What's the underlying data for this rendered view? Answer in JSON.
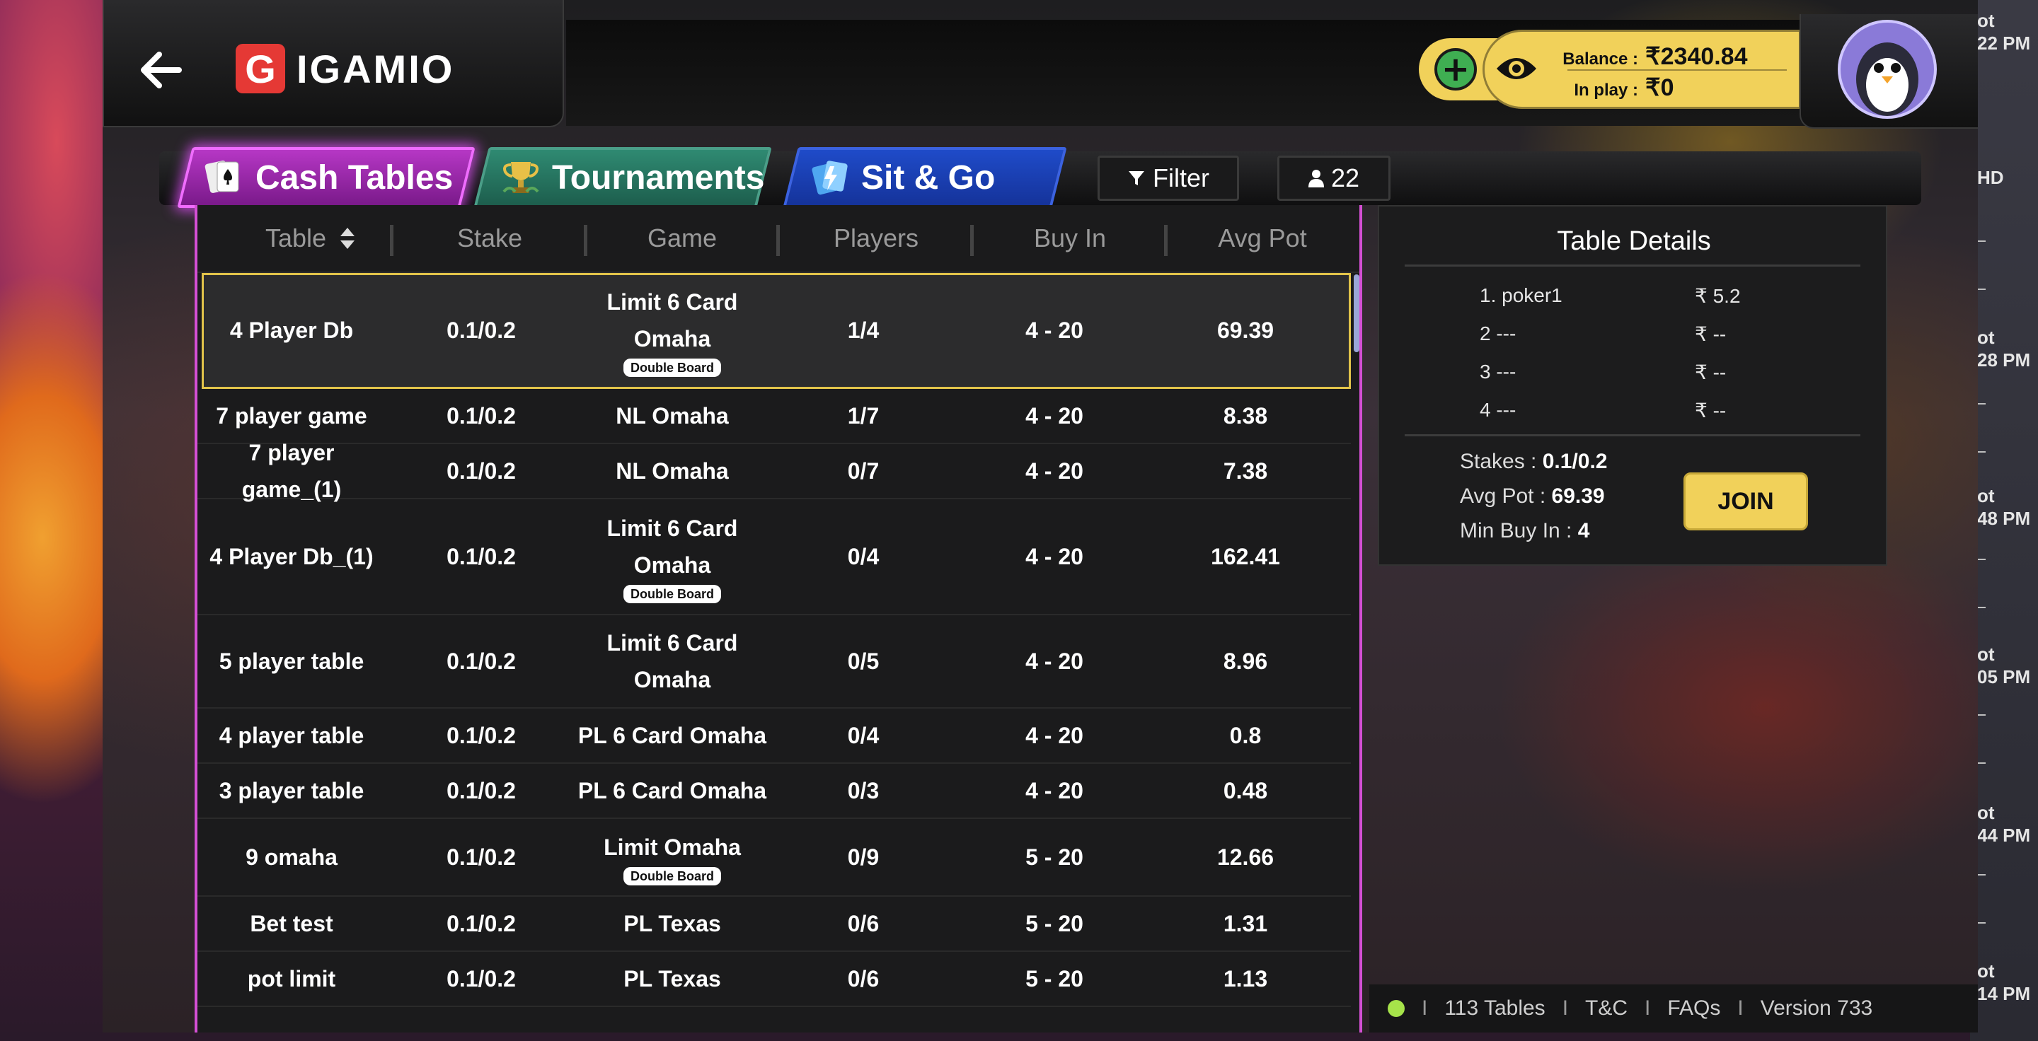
{
  "header": {
    "logo_text": "IGAMIO",
    "logo_mark": "G",
    "balance_label": "Balance :",
    "balance_value": "₹2340.84",
    "inplay_label": "In play :",
    "inplay_value": "₹0"
  },
  "tabs": [
    {
      "label": "Cash Tables",
      "icon": "cards-icon",
      "active": true
    },
    {
      "label": "Tournaments",
      "icon": "trophy-icon",
      "active": false
    },
    {
      "label": "Sit & Go",
      "icon": "lightning-card-icon",
      "active": false
    }
  ],
  "toolbar": {
    "filter_label": "Filter",
    "players_count": "22"
  },
  "table": {
    "columns": [
      "Table",
      "Stake",
      "Game",
      "Players",
      "Buy In",
      "Avg Pot"
    ],
    "rows": [
      {
        "name": "4 Player Db",
        "stake": "0.1/0.2",
        "game": "Limit 6 Card Omaha",
        "badge": "Double Board",
        "players": "1/4",
        "buyin": "4 - 20",
        "avgpot": "69.39",
        "selected": true
      },
      {
        "name": "7 player game",
        "stake": "0.1/0.2",
        "game": "NL Omaha",
        "badge": "",
        "players": "1/7",
        "buyin": "4 - 20",
        "avgpot": "8.38"
      },
      {
        "name": "7 player game_(1)",
        "stake": "0.1/0.2",
        "game": "NL Omaha",
        "badge": "",
        "players": "0/7",
        "buyin": "4 - 20",
        "avgpot": "7.38"
      },
      {
        "name": "4 Player Db_(1)",
        "stake": "0.1/0.2",
        "game": "Limit 6 Card Omaha",
        "badge": "Double Board",
        "players": "0/4",
        "buyin": "4 - 20",
        "avgpot": "162.41"
      },
      {
        "name": "5 player table",
        "stake": "0.1/0.2",
        "game": "Limit 6 Card Omaha",
        "badge": "",
        "players": "0/5",
        "buyin": "4 - 20",
        "avgpot": "8.96"
      },
      {
        "name": "4 player table",
        "stake": "0.1/0.2",
        "game": "PL 6 Card Omaha",
        "badge": "",
        "players": "0/4",
        "buyin": "4 - 20",
        "avgpot": "0.8"
      },
      {
        "name": "3 player table",
        "stake": "0.1/0.2",
        "game": "PL 6 Card Omaha",
        "badge": "",
        "players": "0/3",
        "buyin": "4 - 20",
        "avgpot": "0.48"
      },
      {
        "name": "9 omaha",
        "stake": "0.1/0.2",
        "game": "Limit Omaha",
        "badge": "Double Board",
        "players": "0/9",
        "buyin": "5 - 20",
        "avgpot": "12.66"
      },
      {
        "name": "Bet test",
        "stake": "0.1/0.2",
        "game": "PL Texas",
        "badge": "",
        "players": "0/6",
        "buyin": "5 - 20",
        "avgpot": "1.31"
      },
      {
        "name": "pot limit",
        "stake": "0.1/0.2",
        "game": "PL Texas",
        "badge": "",
        "players": "0/6",
        "buyin": "5 - 20",
        "avgpot": "1.13"
      }
    ]
  },
  "details": {
    "title": "Table Details",
    "seats": [
      {
        "name": "1. poker1",
        "amount": "₹ 5.2"
      },
      {
        "name": "2 ---",
        "amount": "₹ --"
      },
      {
        "name": "3 ---",
        "amount": "₹ --"
      },
      {
        "name": "4 ---",
        "amount": "₹ --"
      }
    ],
    "stakes_label": "Stakes :",
    "stakes_value": "0.1/0.2",
    "avgpot_label": "Avg Pot :",
    "avgpot_value": "69.39",
    "minbuy_label": "Min Buy In :",
    "minbuy_value": "4",
    "join_label": "JOIN"
  },
  "footer": {
    "tables_count": "113 Tables",
    "tnc": "T&C",
    "faqs": "FAQs",
    "version": "Version 733",
    "status_color": "#a6e34a"
  },
  "desktop": {
    "notifications": [
      "ot",
      "22 PM",
      "HD",
      "ot",
      "28 PM",
      "ot",
      "48 PM",
      "ot",
      "05 PM",
      "ot",
      "44 PM",
      "ot",
      "14 PM"
    ]
  }
}
